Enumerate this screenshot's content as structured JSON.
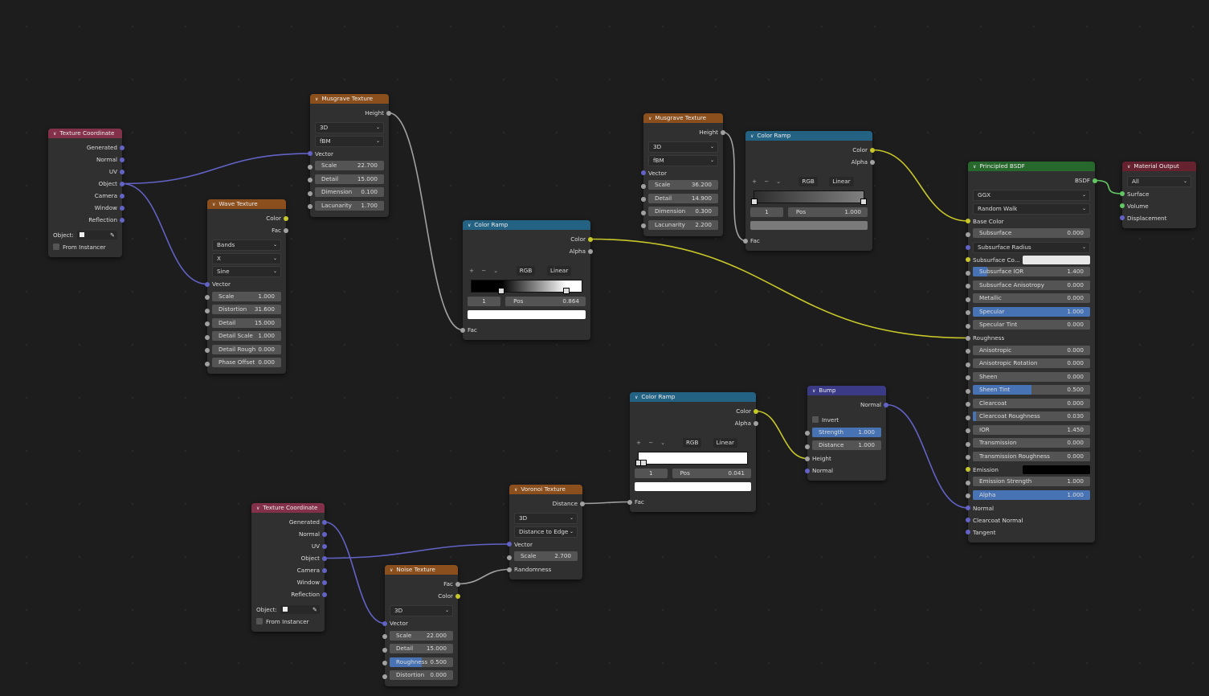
{
  "socket_colors": {
    "vector": "#6363c7",
    "color": "#c7c729",
    "float": "#a1a1a1",
    "shader": "#63c763"
  },
  "header_colors": {
    "input": "#83314a",
    "texture": "#8a4f1c",
    "converter": "#246283",
    "shader": "#27692c",
    "output": "#67222f",
    "vector": "#3b3a86"
  },
  "nodes": [
    {
      "id": "tc1",
      "title": "Texture Coordinate",
      "kind": "input",
      "rows": [
        {
          "t": "out",
          "label": "Generated",
          "s": "vector"
        },
        {
          "t": "out",
          "label": "Normal",
          "s": "vector"
        },
        {
          "t": "out",
          "label": "UV",
          "s": "vector"
        },
        {
          "t": "out",
          "label": "Object",
          "s": "vector"
        },
        {
          "t": "out",
          "label": "Camera",
          "s": "vector"
        },
        {
          "t": "out",
          "label": "Window",
          "s": "vector"
        },
        {
          "t": "out",
          "label": "Reflection",
          "s": "vector"
        },
        {
          "t": "obj",
          "label": "Object:"
        },
        {
          "t": "check",
          "label": "From Instancer"
        }
      ]
    },
    {
      "id": "mus1",
      "title": "Musgrave Texture",
      "kind": "texture",
      "rows": [
        {
          "t": "out",
          "label": "Height",
          "s": "float"
        },
        {
          "t": "dd",
          "value": "3D"
        },
        {
          "t": "dd",
          "value": "fBM"
        },
        {
          "t": "in",
          "label": "Vector",
          "s": "vector"
        },
        {
          "t": "field",
          "label": "Scale",
          "value": "22.700",
          "s": "float"
        },
        {
          "t": "field",
          "label": "Detail",
          "value": "15.000",
          "s": "float"
        },
        {
          "t": "field",
          "label": "Dimension",
          "value": "0.100",
          "s": "float"
        },
        {
          "t": "field",
          "label": "Lacunarity",
          "value": "1.700",
          "s": "float"
        }
      ]
    },
    {
      "id": "wave",
      "title": "Wave Texture",
      "kind": "texture",
      "rows": [
        {
          "t": "out",
          "label": "Color",
          "s": "color"
        },
        {
          "t": "out",
          "label": "Fac",
          "s": "float"
        },
        {
          "t": "dd",
          "value": "Bands"
        },
        {
          "t": "dd",
          "value": "X"
        },
        {
          "t": "dd",
          "value": "Sine"
        },
        {
          "t": "in",
          "label": "Vector",
          "s": "vector"
        },
        {
          "t": "field",
          "label": "Scale",
          "value": "1.000",
          "s": "float"
        },
        {
          "t": "field",
          "label": "Distortion",
          "value": "31.600",
          "s": "float"
        },
        {
          "t": "field",
          "label": "Detail",
          "value": "15.000",
          "s": "float"
        },
        {
          "t": "field",
          "label": "Detail Scale",
          "value": "1.000",
          "s": "float"
        },
        {
          "t": "field",
          "label": "Detail Rough",
          "value": "0.000",
          "s": "float"
        },
        {
          "t": "field",
          "label": "Phase Offset",
          "value": "0.000",
          "s": "float"
        }
      ]
    },
    {
      "id": "ramp1",
      "title": "Color Ramp",
      "kind": "converter",
      "rows": [
        {
          "t": "out",
          "label": "Color",
          "s": "color"
        },
        {
          "t": "out",
          "label": "Alpha",
          "s": "float"
        },
        {
          "t": "ramp",
          "color_mode": "RGB",
          "interp": "Linear",
          "stops": [
            {
              "pos": 0.27,
              "color": "#000000"
            },
            {
              "pos": 0.864,
              "color": "#ffffff"
            }
          ],
          "index": "1",
          "pos_label": "Pos",
          "pos_value": "0.864",
          "swatch": "#ffffff"
        },
        {
          "t": "in",
          "label": "Fac",
          "s": "float"
        }
      ]
    },
    {
      "id": "mus2",
      "title": "Musgrave Texture",
      "kind": "texture",
      "rows": [
        {
          "t": "out",
          "label": "Height",
          "s": "float"
        },
        {
          "t": "dd",
          "value": "3D"
        },
        {
          "t": "dd",
          "value": "fBM"
        },
        {
          "t": "in",
          "label": "Vector",
          "s": "vector"
        },
        {
          "t": "field",
          "label": "Scale",
          "value": "36.200",
          "s": "float"
        },
        {
          "t": "field",
          "label": "Detail",
          "value": "14.900",
          "s": "float"
        },
        {
          "t": "field",
          "label": "Dimension",
          "value": "0.300",
          "s": "float"
        },
        {
          "t": "field",
          "label": "Lacunarity",
          "value": "2.200",
          "s": "float"
        }
      ]
    },
    {
      "id": "ramp2",
      "title": "Color Ramp",
      "kind": "converter",
      "rows": [
        {
          "t": "out",
          "label": "Color",
          "s": "color"
        },
        {
          "t": "out",
          "label": "Alpha",
          "s": "float"
        },
        {
          "t": "ramp",
          "color_mode": "RGB",
          "interp": "Linear",
          "stops": [
            {
              "pos": 0,
              "color": "#2e2e2e"
            },
            {
              "pos": 1,
              "color": "#808080"
            }
          ],
          "index": "1",
          "pos_label": "Pos",
          "pos_value": "1.000",
          "swatch": "#7a7a7a"
        },
        {
          "t": "in",
          "label": "Fac",
          "s": "float"
        }
      ]
    },
    {
      "id": "bsdf",
      "title": "Principled BSDF",
      "kind": "shader",
      "rows": [
        {
          "t": "out",
          "label": "BSDF",
          "s": "shader"
        },
        {
          "t": "dd",
          "value": "GGX"
        },
        {
          "t": "dd",
          "value": "Random Walk"
        },
        {
          "t": "in",
          "label": "Base Color",
          "s": "color"
        },
        {
          "t": "field",
          "label": "Subsurface",
          "value": "0.000",
          "s": "float",
          "fill": 0
        },
        {
          "t": "dd",
          "value": "Subsurface Radius",
          "s": "vector"
        },
        {
          "t": "swatch",
          "label": "Subsurface Co...",
          "color": "#e8e8e8",
          "s": "color"
        },
        {
          "t": "field",
          "label": "Subsurface IOR",
          "value": "1.400",
          "s": "float",
          "fill": 0.12
        },
        {
          "t": "field",
          "label": "Subsurface Anisotropy",
          "value": "0.000",
          "s": "float",
          "fill": 0
        },
        {
          "t": "field",
          "label": "Metallic",
          "value": "0.000",
          "s": "float",
          "fill": 0
        },
        {
          "t": "field",
          "label": "Specular",
          "value": "1.000",
          "s": "float",
          "fill": 1
        },
        {
          "t": "field",
          "label": "Specular Tint",
          "value": "0.000",
          "s": "float",
          "fill": 0
        },
        {
          "t": "in",
          "label": "Roughness",
          "s": "float"
        },
        {
          "t": "field",
          "label": "Anisotropic",
          "value": "0.000",
          "s": "float",
          "fill": 0
        },
        {
          "t": "field",
          "label": "Anisotropic Rotation",
          "value": "0.000",
          "s": "float",
          "fill": 0
        },
        {
          "t": "field",
          "label": "Sheen",
          "value": "0.000",
          "s": "float",
          "fill": 0
        },
        {
          "t": "field",
          "label": "Sheen Tint",
          "value": "0.500",
          "s": "float",
          "fill": 0.5
        },
        {
          "t": "field",
          "label": "Clearcoat",
          "value": "0.000",
          "s": "float",
          "fill": 0
        },
        {
          "t": "field",
          "label": "Clearcoat Roughness",
          "value": "0.030",
          "s": "float",
          "fill": 0.03
        },
        {
          "t": "field",
          "label": "IOR",
          "value": "1.450",
          "s": "float"
        },
        {
          "t": "field",
          "label": "Transmission",
          "value": "0.000",
          "s": "float",
          "fill": 0
        },
        {
          "t": "field",
          "label": "Transmission Roughness",
          "value": "0.000",
          "s": "float",
          "fill": 0
        },
        {
          "t": "swatch",
          "label": "Emission",
          "color": "#000000",
          "s": "color"
        },
        {
          "t": "field",
          "label": "Emission Strength",
          "value": "1.000",
          "s": "float"
        },
        {
          "t": "field",
          "label": "Alpha",
          "value": "1.000",
          "s": "float",
          "fill": 1
        },
        {
          "t": "in",
          "label": "Normal",
          "s": "vector"
        },
        {
          "t": "in",
          "label": "Clearcoat Normal",
          "s": "vector"
        },
        {
          "t": "in",
          "label": "Tangent",
          "s": "vector"
        }
      ]
    },
    {
      "id": "matout",
      "title": "Material Output",
      "kind": "output",
      "rows": [
        {
          "t": "dd",
          "value": "All"
        },
        {
          "t": "in",
          "label": "Surface",
          "s": "shader"
        },
        {
          "t": "in",
          "label": "Volume",
          "s": "shader"
        },
        {
          "t": "in",
          "label": "Displacement",
          "s": "vector"
        }
      ]
    },
    {
      "id": "ramp3",
      "title": "Color Ramp",
      "kind": "converter",
      "rows": [
        {
          "t": "out",
          "label": "Color",
          "s": "color"
        },
        {
          "t": "out",
          "label": "Alpha",
          "s": "float"
        },
        {
          "t": "ramp",
          "color_mode": "RGB",
          "interp": "Linear",
          "stops": [
            {
              "pos": 0.0,
              "color": "#ffffff"
            },
            {
              "pos": 0.041,
              "color": "#ffffff"
            }
          ],
          "index": "1",
          "pos_label": "Pos",
          "pos_value": "0.041",
          "swatch": "#ffffff"
        },
        {
          "t": "in",
          "label": "Fac",
          "s": "float"
        }
      ]
    },
    {
      "id": "bump",
      "title": "Bump",
      "kind": "vector",
      "rows": [
        {
          "t": "out",
          "label": "Normal",
          "s": "vector"
        },
        {
          "t": "check",
          "label": "Invert"
        },
        {
          "t": "field",
          "label": "Strength",
          "value": "1.000",
          "s": "float",
          "fill": 1
        },
        {
          "t": "field",
          "label": "Distance",
          "value": "1.000",
          "s": "float"
        },
        {
          "t": "in",
          "label": "Height",
          "s": "float"
        },
        {
          "t": "in",
          "label": "Normal",
          "s": "vector"
        }
      ]
    },
    {
      "id": "vor",
      "title": "Voronoi Texture",
      "kind": "texture",
      "rows": [
        {
          "t": "out",
          "label": "Distance",
          "s": "float"
        },
        {
          "t": "dd",
          "value": "3D"
        },
        {
          "t": "dd",
          "value": "Distance to Edge"
        },
        {
          "t": "in",
          "label": "Vector",
          "s": "vector"
        },
        {
          "t": "field",
          "label": "Scale",
          "value": "2.700",
          "s": "float"
        },
        {
          "t": "in",
          "label": "Randomness",
          "s": "float"
        }
      ]
    },
    {
      "id": "tc2",
      "title": "Texture Coordinate",
      "kind": "input",
      "rows": [
        {
          "t": "out",
          "label": "Generated",
          "s": "vector"
        },
        {
          "t": "out",
          "label": "Normal",
          "s": "vector"
        },
        {
          "t": "out",
          "label": "UV",
          "s": "vector"
        },
        {
          "t": "out",
          "label": "Object",
          "s": "vector"
        },
        {
          "t": "out",
          "label": "Camera",
          "s": "vector"
        },
        {
          "t": "out",
          "label": "Window",
          "s": "vector"
        },
        {
          "t": "out",
          "label": "Reflection",
          "s": "vector"
        },
        {
          "t": "obj",
          "label": "Object:"
        },
        {
          "t": "check",
          "label": "From Instancer"
        }
      ]
    },
    {
      "id": "noise",
      "title": "Noise Texture",
      "kind": "texture",
      "rows": [
        {
          "t": "out",
          "label": "Fac",
          "s": "float"
        },
        {
          "t": "out",
          "label": "Color",
          "s": "color"
        },
        {
          "t": "dd",
          "value": "3D"
        },
        {
          "t": "in",
          "label": "Vector",
          "s": "vector"
        },
        {
          "t": "field",
          "label": "Scale",
          "value": "22.000",
          "s": "float"
        },
        {
          "t": "field",
          "label": "Detail",
          "value": "15.000",
          "s": "float"
        },
        {
          "t": "field",
          "label": "Roughness",
          "value": "0.500",
          "s": "float",
          "fill": 0.5
        },
        {
          "t": "field",
          "label": "Distortion",
          "value": "0.000",
          "s": "float"
        }
      ]
    }
  ],
  "links": [
    {
      "from": [
        "tc1",
        "Object"
      ],
      "to": [
        "mus1",
        "Vector"
      ],
      "s": "vector"
    },
    {
      "from": [
        "tc1",
        "Object"
      ],
      "to": [
        "wave",
        "Vector"
      ],
      "s": "vector"
    },
    {
      "from": [
        "mus1",
        "Height"
      ],
      "to": [
        "ramp1",
        "Fac"
      ],
      "s": "float"
    },
    {
      "from": [
        "ramp1",
        "Color"
      ],
      "to": [
        "bsdf",
        "Roughness"
      ],
      "s": "color"
    },
    {
      "from": [
        "mus2",
        "Height"
      ],
      "to": [
        "ramp2",
        "Fac"
      ],
      "s": "float"
    },
    {
      "from": [
        "ramp2",
        "Color"
      ],
      "to": [
        "bsdf",
        "Base Color"
      ],
      "s": "color"
    },
    {
      "from": [
        "bsdf",
        "BSDF"
      ],
      "to": [
        "matout",
        "Surface"
      ],
      "s": "shader"
    },
    {
      "from": [
        "tc2",
        "Generated"
      ],
      "to": [
        "noise",
        "Vector"
      ],
      "s": "vector"
    },
    {
      "from": [
        "tc2",
        "Object"
      ],
      "to": [
        "vor",
        "Vector"
      ],
      "s": "vector"
    },
    {
      "from": [
        "noise",
        "Fac"
      ],
      "to": [
        "vor",
        "Randomness"
      ],
      "s": "float"
    },
    {
      "from": [
        "vor",
        "Distance"
      ],
      "to": [
        "ramp3",
        "Fac"
      ],
      "s": "float"
    },
    {
      "from": [
        "ramp3",
        "Color"
      ],
      "to": [
        "bump",
        "Height"
      ],
      "s": "color"
    },
    {
      "from": [
        "bump",
        "Normal"
      ],
      "to": [
        "bsdf",
        "Normal"
      ],
      "s": "vector"
    }
  ],
  "ramp_buttons": {
    "add": "+",
    "remove": "−",
    "menu": "⌄"
  }
}
